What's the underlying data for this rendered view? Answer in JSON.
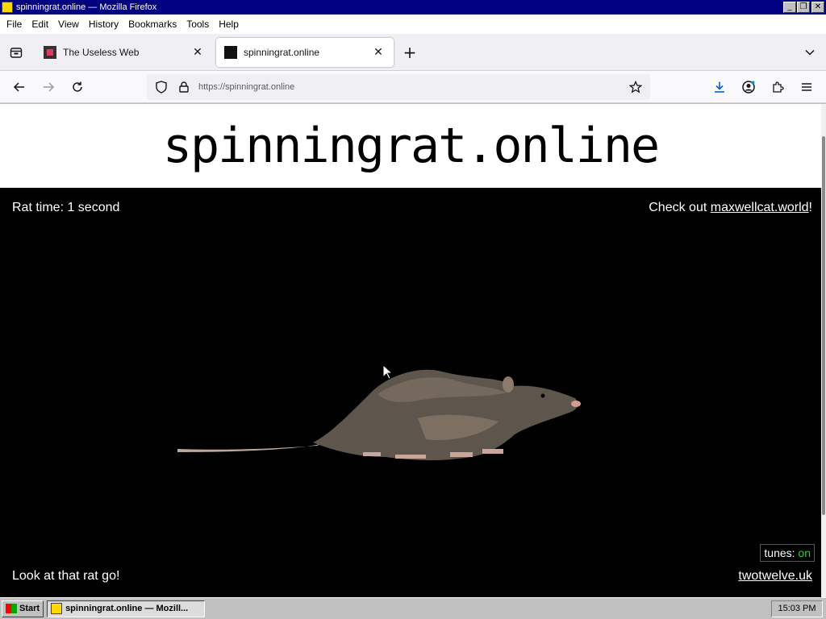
{
  "window": {
    "title": "spinningrat.online — Mozilla Firefox",
    "controls": {
      "minimize": "_",
      "restore": "❐",
      "close": "✕"
    }
  },
  "menubar": {
    "items": [
      "File",
      "Edit",
      "View",
      "History",
      "Bookmarks",
      "Tools",
      "Help"
    ]
  },
  "tabs": [
    {
      "label": "The Useless Web",
      "active": false
    },
    {
      "label": "spinningrat.online",
      "active": true
    }
  ],
  "tab_close_glyph": "✕",
  "new_tab_glyph": "+",
  "urlbar": {
    "url": "https://spinningrat.online"
  },
  "page": {
    "site_title": "spinningrat.online",
    "rat_time_label": "Rat time: 1 second",
    "check_out_prefix": "Check out ",
    "check_out_link": "maxwellcat.world",
    "check_out_suffix": "!",
    "tagline": "Look at that rat go!",
    "footer_link": "twotwelve.uk",
    "tunes_label": "tunes: ",
    "tunes_state": "on"
  },
  "taskbar": {
    "start_label": "Start",
    "task_label": "spinningrat.online — Mozill...",
    "clock": "15:03 PM"
  },
  "colors": {
    "titlebar": "#000080",
    "page_bg": "#000000",
    "header_bg": "#ffffff",
    "tunes_on": "#2ecc40"
  }
}
